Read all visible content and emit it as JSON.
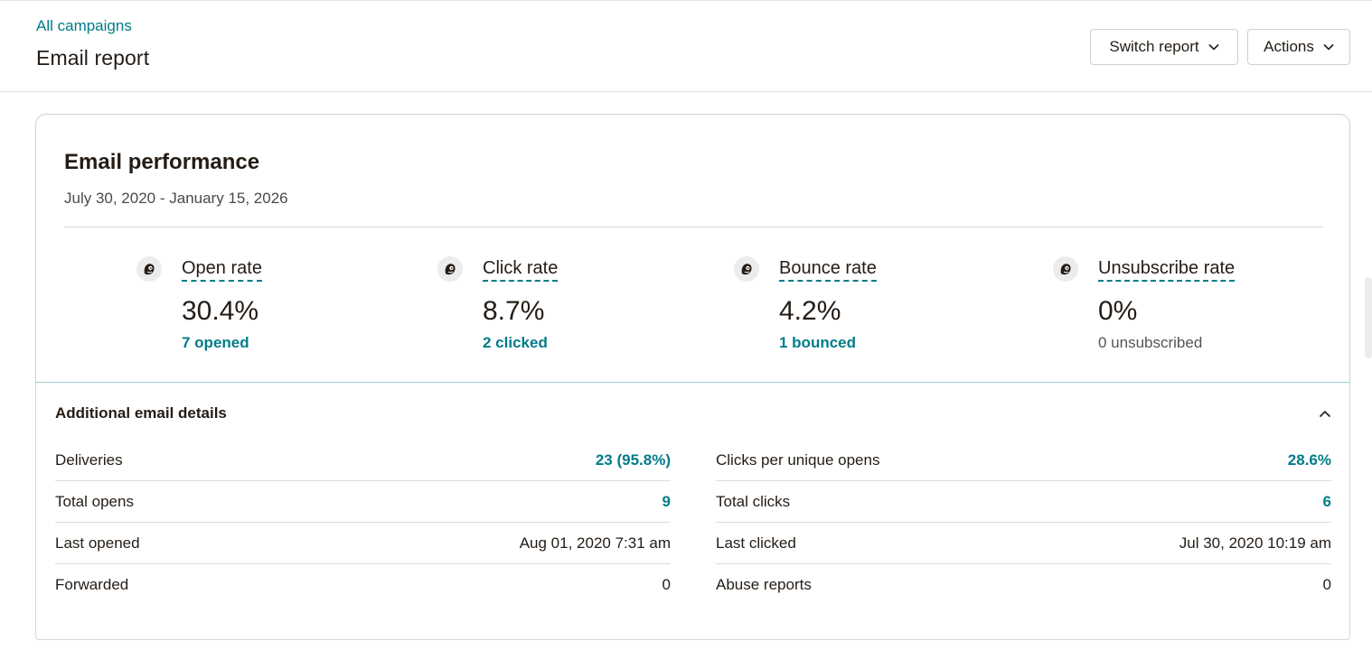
{
  "header": {
    "breadcrumb": "All campaigns",
    "title": "Email report",
    "switch_report_label": "Switch report",
    "actions_label": "Actions"
  },
  "performance": {
    "title": "Email performance",
    "date_range": "July 30, 2020 - January 15, 2026",
    "metrics": [
      {
        "label": "Open rate",
        "value": "30.4%",
        "sub": "7 opened",
        "icon": "freddie-icon"
      },
      {
        "label": "Click rate",
        "value": "8.7%",
        "sub": "2 clicked",
        "icon": "freddie-icon"
      },
      {
        "label": "Bounce rate",
        "value": "4.2%",
        "sub": "1 bounced",
        "icon": "freddie-icon"
      },
      {
        "label": "Unsubscribe rate",
        "value": "0%",
        "sub": "0 unsubscribed",
        "icon": "freddie-icon"
      }
    ]
  },
  "details": {
    "title": "Additional email details",
    "left": [
      {
        "label": "Deliveries",
        "value": "23 (95.8%)"
      },
      {
        "label": "Total opens",
        "value": "9"
      },
      {
        "label": "Last opened",
        "value": "Aug 01, 2020 7:31 am"
      },
      {
        "label": "Forwarded",
        "value": "0"
      }
    ],
    "right": [
      {
        "label": "Clicks per unique opens",
        "value": "28.6%"
      },
      {
        "label": "Total clicks",
        "value": "6"
      },
      {
        "label": "Last clicked",
        "value": "Jul 30, 2020 10:19 am"
      },
      {
        "label": "Abuse reports",
        "value": "0"
      }
    ]
  },
  "colors": {
    "accent": "#007c89",
    "text": "#241c15",
    "border": "#cfcfcf"
  }
}
